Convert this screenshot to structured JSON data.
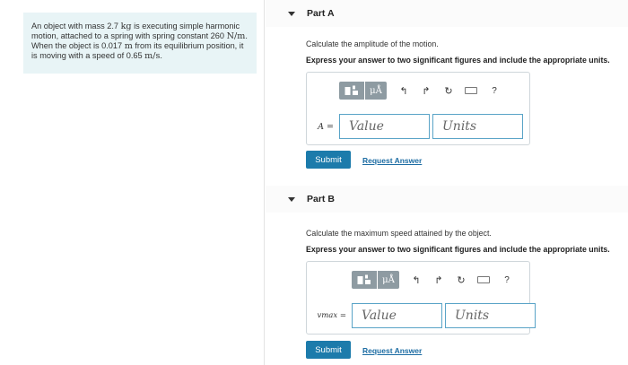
{
  "problem": {
    "t1": "An object with mass 2.7",
    "m1": "kg",
    "t2": " is executing simple harmonic motion, attached to a spring with spring constant 260",
    "m2": "N/m",
    "t3": ". When the object is 0.017",
    "m3": "m",
    "t4": " from its equilibrium position, it is moving with a speed of 0.65",
    "m4": "m/s",
    "t5": "."
  },
  "toolbar": {
    "template_icon": "template-icon",
    "units_symbol": "μÅ",
    "undo": "↰",
    "redo": "↱",
    "reset": "↻",
    "keyboard_icon": "keyboard-icon",
    "help": "?"
  },
  "parts": [
    {
      "title": "Part A",
      "question": "Calculate the amplitude of the motion.",
      "instruction": "Express your answer to two significant figures and include the appropriate units.",
      "var_label": "A =",
      "value_placeholder": "Value",
      "units_placeholder": "Units",
      "submit": "Submit",
      "request": "Request Answer"
    },
    {
      "title": "Part B",
      "question": "Calculate the maximum speed attained by the object.",
      "instruction": "Express your answer to two significant figures and include the appropriate units.",
      "var_label": "vmax =",
      "value_placeholder": "Value",
      "units_placeholder": "Units",
      "submit": "Submit",
      "request": "Request Answer"
    }
  ],
  "colors": {
    "problem_bg": "#e8f4f6",
    "submit_bg": "#1c7bab",
    "field_border": "#5aa4c7",
    "link": "#1c6ca3"
  }
}
